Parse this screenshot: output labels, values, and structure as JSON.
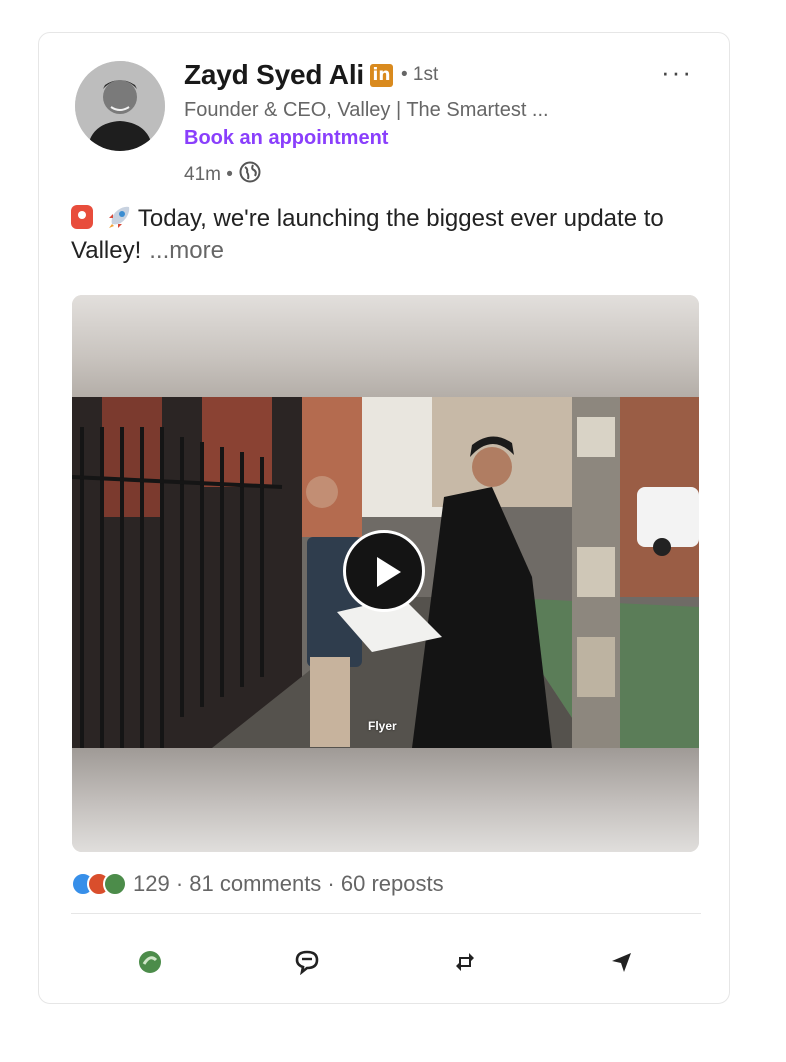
{
  "post": {
    "author_name": "Zayd Syed Ali",
    "badge_label": "in",
    "connection_degree": "• 1st",
    "headline": "Founder & CEO, Valley | The Smartest ...",
    "cta_label": "Book an appointment",
    "time_ago": "41m •",
    "more_menu_label": "···",
    "text_line": "Today, we're launching the biggest ever update to Valley!",
    "see_more_label": "...more",
    "video_caption": "Flyer"
  },
  "social": {
    "counts_text": "129 · 81 comments · 60 reposts",
    "reaction_icons": [
      "like-icon",
      "celebrate-icon",
      "support-icon"
    ]
  },
  "actions": [
    {
      "name": "react-button",
      "icon": "support-icon"
    },
    {
      "name": "comment-button",
      "icon": "comment-icon"
    },
    {
      "name": "repost-button",
      "icon": "repost-icon"
    },
    {
      "name": "send-button",
      "icon": "send-icon"
    }
  ],
  "colors": {
    "cta": "#8a3ffc",
    "badge": "#d98a1e",
    "muted_text": "#666666"
  }
}
